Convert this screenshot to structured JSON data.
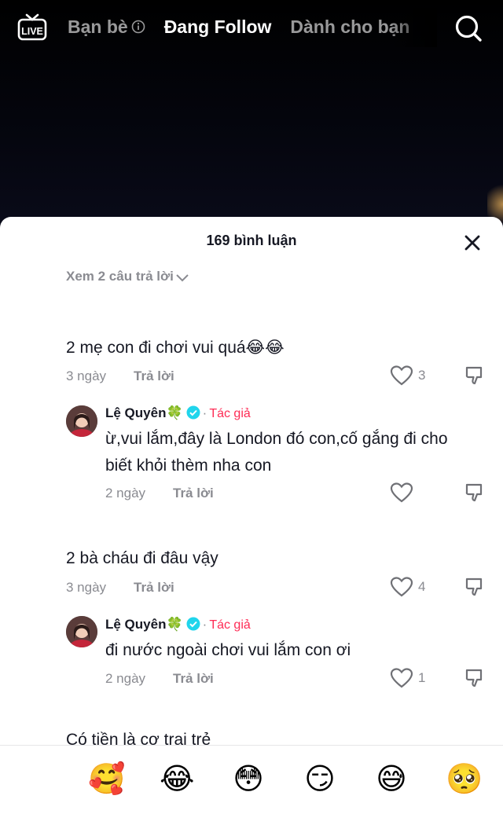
{
  "top_nav": {
    "live_label": "LIVE",
    "tabs": [
      {
        "label": "Bạn bè"
      },
      {
        "label": "Đang Follow"
      },
      {
        "label": "Dành cho bạn"
      }
    ]
  },
  "comments_sheet": {
    "title": "169 bình luận",
    "view_more_replies": "Xem 2 câu trả lời",
    "comments": [
      {
        "text": "2 mẹ con đi chơi vui quá😂😂",
        "time": "3 ngày",
        "reply_label": "Trả lời",
        "likes": "3",
        "reply": {
          "author": "Lệ Quyên",
          "author_emoji": "🍀",
          "tag": "Tác giả",
          "text": "ừ,vui lắm,đây là London đó con,cố gắng đi cho biết khỏi thèm nha con",
          "time": "2 ngày",
          "reply_label": "Trả lời",
          "likes": ""
        }
      },
      {
        "text": "2 bà cháu đi đâu vậy",
        "time": "3 ngày",
        "reply_label": "Trả lời",
        "likes": "4",
        "reply": {
          "author": "Lệ Quyên",
          "author_emoji": "🍀",
          "tag": "Tác giả",
          "text": "đi nước ngoài chơi vui lắm con ơi",
          "time": "2 ngày",
          "reply_label": "Trả lời",
          "likes": "1"
        }
      }
    ],
    "partial_comment": "Có tiền là cơ trai trẻ"
  },
  "emoji_bar": [
    "🥰",
    "😂",
    "😳",
    "😏",
    "😅",
    "🥺"
  ],
  "colors": {
    "accent": "#fe2c55",
    "verified": "#20d5ec",
    "muted": "#8a8b91",
    "text": "#161823"
  }
}
